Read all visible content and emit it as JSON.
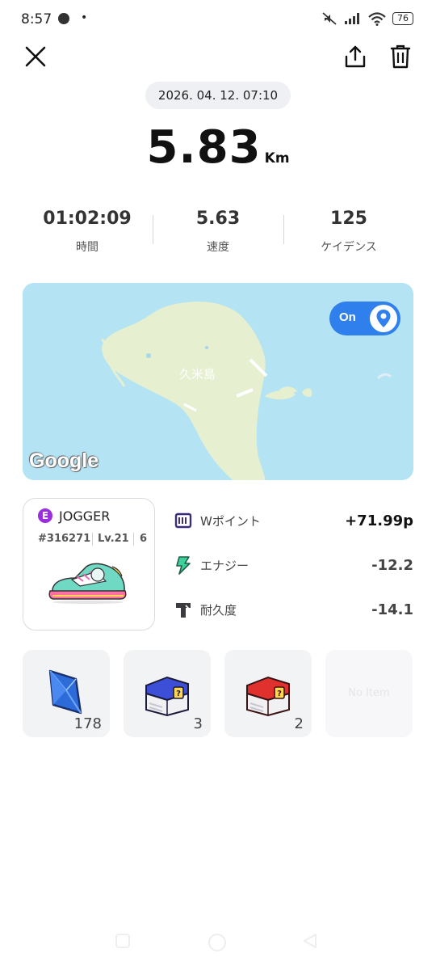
{
  "status_bar": {
    "time": "8:57",
    "dot": "•",
    "battery": "76"
  },
  "run": {
    "date": "2026. 04. 12. 07:10",
    "distance": "5.83",
    "distance_unit": "Km",
    "stats": [
      {
        "value": "01:02:09",
        "label": "時間"
      },
      {
        "value": "5.63",
        "label": "速度"
      },
      {
        "value": "125",
        "label": "ケイデンス"
      }
    ]
  },
  "map": {
    "place_label": "久米島",
    "toggle_label": "On",
    "provider": "Google"
  },
  "sneaker": {
    "badge": "E",
    "type": "JOGGER",
    "id": "#316271",
    "level": "Lv.21",
    "extra": "6"
  },
  "rewards": [
    {
      "icon": "w-point-icon",
      "label": "Wポイント",
      "value": "+71.99p"
    },
    {
      "icon": "energy-bolt-icon",
      "label": "エナジー",
      "value": "-12.2"
    },
    {
      "icon": "durability-icon",
      "label": "耐久度",
      "value": "-14.1"
    }
  ],
  "items": [
    {
      "icon": "blue-gem-icon",
      "count": "178"
    },
    {
      "icon": "blue-mystery-box-icon",
      "count": "3"
    },
    {
      "icon": "red-mystery-box-icon",
      "count": "2"
    },
    {
      "empty_label": "No Item"
    }
  ],
  "colors": {
    "accent": "#2f80ed",
    "map_water": "#b4e3f4",
    "map_land": "#e6efcf",
    "rarity_purple": "#9b2de0"
  }
}
